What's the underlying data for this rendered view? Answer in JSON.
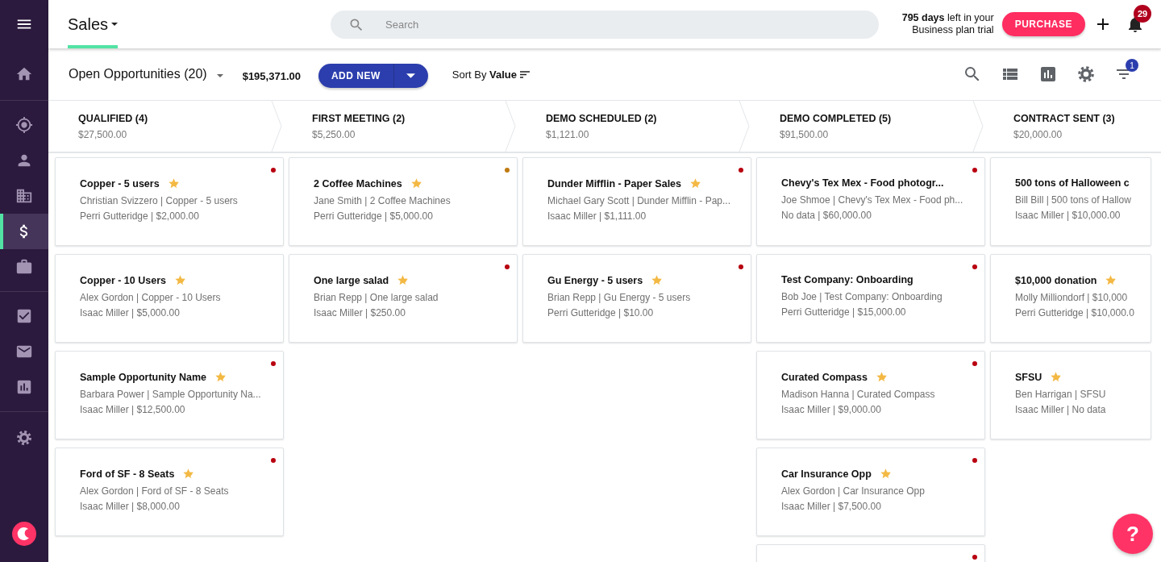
{
  "sidebar": {
    "groups": [
      {
        "items": [
          {
            "kind": "menu",
            "selected": false
          },
          {
            "kind": "home",
            "selected": false
          }
        ]
      },
      {
        "items": [
          {
            "kind": "target",
            "selected": false
          },
          {
            "kind": "person",
            "selected": false
          },
          {
            "kind": "building",
            "selected": false
          },
          {
            "kind": "dollar",
            "selected": true
          },
          {
            "kind": "briefcase",
            "selected": false
          }
        ]
      },
      {
        "items": [
          {
            "kind": "checkbox",
            "selected": false
          },
          {
            "kind": "mail",
            "selected": false
          },
          {
            "kind": "chart",
            "selected": false
          }
        ]
      },
      {
        "items": [
          {
            "kind": "settings",
            "selected": false
          }
        ]
      }
    ]
  },
  "header": {
    "tab": {
      "label": "Sales",
      "selected": true
    },
    "search": {
      "placeholder": "Search"
    },
    "trial_text": "**795 days** left in your Business plan trial",
    "purchase_button": "PURCHASE",
    "notifications": {
      "badge": "29"
    }
  },
  "toolbar": {
    "view_selector": "Open Opportunities (20)",
    "total": "$195,371.00",
    "add_button": "ADD NEW",
    "sort": "Sort By **Value**",
    "tools": [
      {
        "kind": "search"
      },
      {
        "kind": "list"
      },
      {
        "kind": "chart"
      },
      {
        "kind": "settings"
      },
      {
        "kind": "filter",
        "badge": "1"
      }
    ]
  },
  "stages": [
    {
      "title": "QUALIFIED (4)",
      "amount": "$27,500.00",
      "cards": [
        {
          "title": "Copper - 5 users",
          "starred": true,
          "contact_line": "Christian Svizzero | Copper - 5 users",
          "owner_line": "Perri Gutteridge | $2,000.00",
          "color": "#b80010"
        },
        {
          "title": "Copper - 10 Users",
          "starred": true,
          "contact_line": "Alex Gordon | Copper - 10 Users",
          "owner_line": "Isaac Miller | $5,000.00"
        },
        {
          "title": "Sample Opportunity Name",
          "starred": true,
          "contact_line": "Barbara Power | Sample Opportunity Na...",
          "owner_line": "Isaac Miller | $12,500.00",
          "color": "#b80010"
        },
        {
          "title": "Ford of SF - 8 Seats",
          "starred": true,
          "contact_line": "Alex Gordon | Ford of SF - 8 Seats",
          "owner_line": "Isaac Miller | $8,000.00",
          "color": "#b80010"
        }
      ]
    },
    {
      "title": "FIRST MEETING (2)",
      "amount": "$5,250.00",
      "cards": [
        {
          "title": "2 Coffee Machines",
          "starred": true,
          "contact_line": "Jane Smith | 2 Coffee Machines",
          "owner_line": "Perri Gutteridge | $5,000.00",
          "color": "#c07a10"
        },
        {
          "title": "One large salad",
          "starred": true,
          "contact_line": "Brian Repp | One large salad",
          "owner_line": "Isaac Miller | $250.00",
          "color": "#b80010"
        }
      ]
    },
    {
      "title": "DEMO SCHEDULED (2)",
      "amount": "$1,121.00",
      "cards": [
        {
          "title": "Dunder Mifflin - Paper Sales",
          "starred": true,
          "contact_line": "Michael Gary Scott | Dunder Mifflin - Pap...",
          "owner_line": "Isaac Miller | $1,111.00",
          "color": "#b80010"
        },
        {
          "title": "Gu Energy - 5 users",
          "starred": true,
          "contact_line": "Brian Repp | Gu Energy - 5 users",
          "owner_line": "Perri Gutteridge | $10.00",
          "color": "#b80010"
        }
      ]
    },
    {
      "title": "DEMO COMPLETED (5)",
      "amount": "$91,500.00",
      "cards": [
        {
          "title": "Chevy's Tex Mex - Food photogr...",
          "starred": false,
          "contact_line": "Joe Shmoe | Chevy's Tex Mex - Food ph...",
          "owner_line": "No data | $60,000.00",
          "color": "#b80010"
        },
        {
          "title": "Test Company: Onboarding",
          "starred": false,
          "contact_line": "Bob Joe | Test Company: Onboarding",
          "owner_line": "Perri Gutteridge | $15,000.00",
          "color": "#b80010"
        },
        {
          "title": "Curated Compass",
          "starred": true,
          "contact_line": "Madison Hanna | Curated Compass",
          "owner_line": "Isaac Miller | $9,000.00",
          "color": "#b80010"
        },
        {
          "title": "Car Insurance Opp",
          "starred": true,
          "contact_line": "Alex Gordon | Car Insurance Opp",
          "owner_line": "Isaac Miller | $7,500.00",
          "color": "#b80010"
        },
        {
          "color": "#b80010"
        }
      ]
    },
    {
      "title": "CONTRACT SENT (3)",
      "amount": "$20,000.00",
      "cards": [
        {
          "title": "500 tons of Halloween c",
          "starred": false,
          "contact_line": "Bill Bill | 500 tons of Hallow",
          "owner_line": "Isaac Miller | $10,000.00"
        },
        {
          "title": "$10,000 donation",
          "starred": true,
          "contact_line": "Molly Milliondorf | $10,000",
          "owner_line": "Perri Gutteridge | $10,000.0"
        },
        {
          "title": "SFSU",
          "starred": true,
          "contact_line": "Ben Harrigan | SFSU",
          "owner_line": "Isaac Miller | No data"
        }
      ]
    }
  ],
  "help_button": {
    "label": "?"
  }
}
